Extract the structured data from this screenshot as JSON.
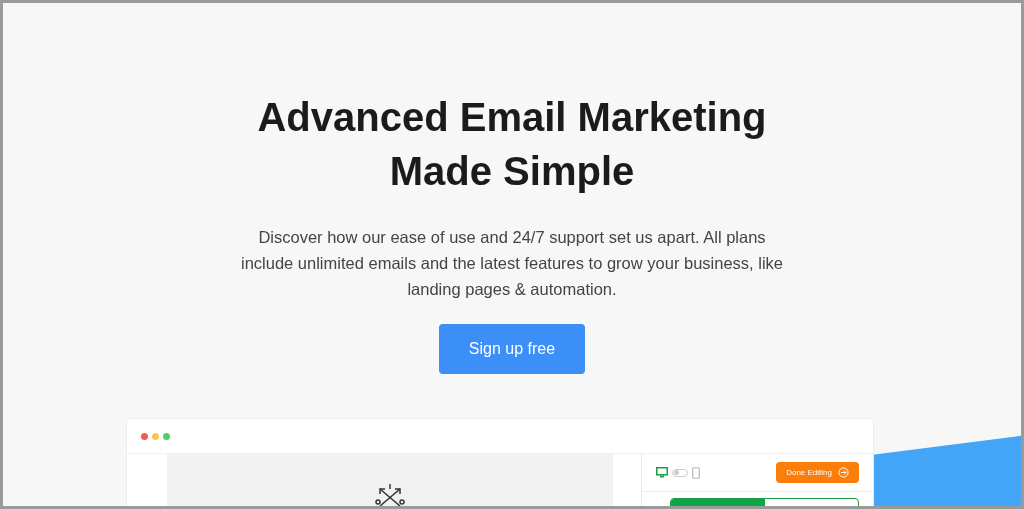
{
  "hero": {
    "title_lines": [
      "Advanced Email Marketing",
      "Made Simple"
    ],
    "description": "Discover how our ease of use and 24/7 support set us apart. All plans include unlimited emails and the latest features to grow your business, like landing pages & automation.",
    "cta": "Sign up free"
  },
  "editor_preview": {
    "devices": [
      {
        "kind": "desktop",
        "selected": true
      },
      {
        "kind": "mobile",
        "selected": false
      }
    ],
    "done_button": "Done Editing",
    "progress": {
      "level": 0.5
    }
  }
}
